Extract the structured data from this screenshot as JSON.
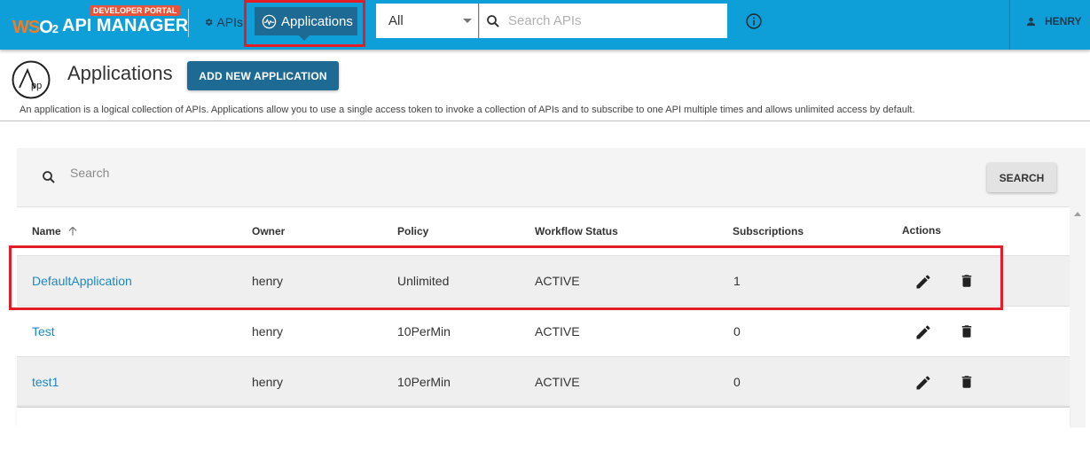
{
  "header": {
    "logo_wso": "WS",
    "logo_o2": "O",
    "logo_2": "2",
    "product": "API MANAGER",
    "badge": "DEVELOPER PORTAL",
    "nav_apis_label": "APIs",
    "nav_apps_label": "Applications",
    "search_scope": "All",
    "search_placeholder": "Search APIs",
    "user_name": "HENRY"
  },
  "page": {
    "title": "Applications",
    "add_button": "ADD NEW APPLICATION",
    "description": "An application is a logical collection of APIs. Applications allow you to use a single access token to invoke a collection of APIs and to subscribe to one API multiple times and allows unlimited access by default."
  },
  "toolbar": {
    "search_placeholder": "Search",
    "search_button": "SEARCH"
  },
  "table": {
    "columns": [
      "Name",
      "Owner",
      "Policy",
      "Workflow Status",
      "Subscriptions",
      "Actions"
    ],
    "rows": [
      {
        "name": "DefaultApplication",
        "owner": "henry",
        "policy": "Unlimited",
        "status": "ACTIVE",
        "subscriptions": "1"
      },
      {
        "name": "Test",
        "owner": "henry",
        "policy": "10PerMin",
        "status": "ACTIVE",
        "subscriptions": "0"
      },
      {
        "name": "test1",
        "owner": "henry",
        "policy": "10PerMin",
        "status": "ACTIVE",
        "subscriptions": "0"
      }
    ]
  },
  "colors": {
    "header_bg": "#0f9fd8",
    "accent": "#1d6b95",
    "link": "#1d88c3",
    "highlight": "#e11d28"
  },
  "icons": {
    "nav_apis": "gear-icon",
    "nav_apps": "activity-icon",
    "search": "search-icon",
    "info": "info-icon",
    "user": "person-icon",
    "sort": "arrow-up-icon",
    "edit": "pencil-icon",
    "delete": "trash-icon"
  }
}
